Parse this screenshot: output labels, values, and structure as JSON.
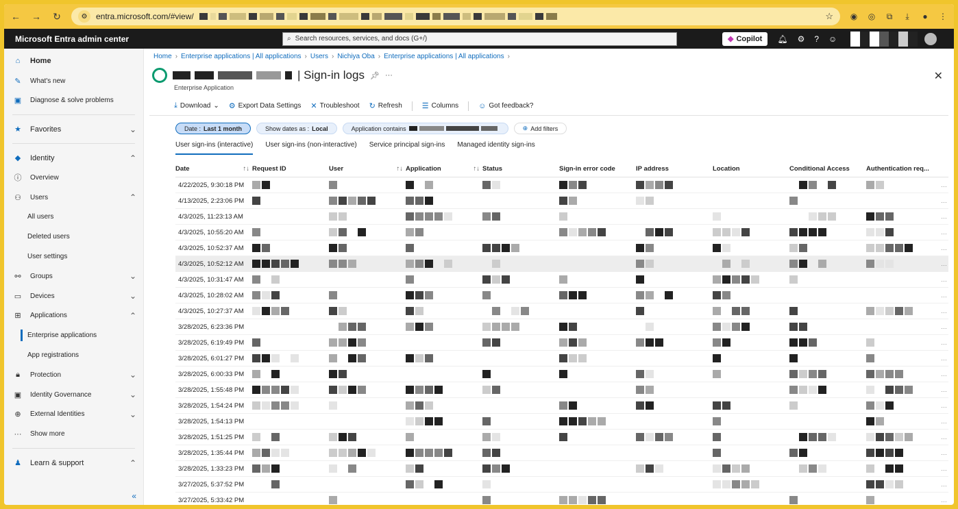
{
  "browser": {
    "url": "entra.microsoft.com/#view/",
    "icons": [
      "back-icon",
      "forward-icon",
      "reload-icon",
      "site-settings-icon",
      "star-icon",
      "download-icon",
      "menu-icon"
    ]
  },
  "portal": {
    "title": "Microsoft Entra admin center",
    "search_placeholder": "Search resources, services, and docs (G+/)",
    "copilot_label": "Copilot"
  },
  "sidebar": {
    "items": [
      {
        "label": "Home",
        "icon": "home-icon"
      },
      {
        "label": "What's new",
        "icon": "megaphone-icon"
      },
      {
        "label": "Diagnose & solve problems",
        "icon": "diagnose-icon"
      },
      {
        "label": "Favorites",
        "icon": "star-icon"
      },
      {
        "label": "Identity",
        "icon": "diamond-icon"
      },
      {
        "label": "Overview",
        "icon": "info-icon"
      },
      {
        "label": "Users",
        "icon": "user-icon"
      },
      {
        "label": "All users"
      },
      {
        "label": "Deleted users"
      },
      {
        "label": "User settings"
      },
      {
        "label": "Groups",
        "icon": "groups-icon"
      },
      {
        "label": "Devices",
        "icon": "devices-icon"
      },
      {
        "label": "Applications",
        "icon": "apps-icon"
      },
      {
        "label": "Enterprise applications"
      },
      {
        "label": "App registrations"
      },
      {
        "label": "Protection",
        "icon": "lock-icon"
      },
      {
        "label": "Identity Governance",
        "icon": "governance-icon"
      },
      {
        "label": "External Identities",
        "icon": "external-icon"
      },
      {
        "label": "Show more",
        "icon": "more-icon"
      },
      {
        "label": "Learn & support",
        "icon": "learn-icon"
      }
    ]
  },
  "breadcrumbs": [
    "Home",
    "Enterprise applications | All applications",
    "Users",
    "Nichiya Oba",
    "Enterprise applications | All applications"
  ],
  "page": {
    "title": "| Sign-in logs",
    "subtitle": "Enterprise Application"
  },
  "toolbar": {
    "download": "Download",
    "export": "Export Data Settings",
    "troubleshoot": "Troubleshoot",
    "refresh": "Refresh",
    "columns": "Columns",
    "feedback": "Got feedback?"
  },
  "filters": {
    "date_prefix": "Date : ",
    "date_value": "Last 1 month",
    "tz_prefix": "Show dates as : ",
    "tz_value": "Local",
    "app_prefix": "Application contains",
    "add_filters": "Add filters"
  },
  "tabs": [
    "User sign-ins (interactive)",
    "User sign-ins (non-interactive)",
    "Service principal sign-ins",
    "Managed identity sign-ins"
  ],
  "table": {
    "columns": [
      "Date",
      "Request ID",
      "User",
      "Application",
      "Status",
      "Sign-in error code",
      "IP address",
      "Location",
      "Conditional Access",
      "Authentication req..."
    ],
    "rows": [
      "4/22/2025, 9:30:18 PM",
      "4/13/2025, 2:23:06 PM",
      "4/3/2025, 11:23:13 AM",
      "4/3/2025, 10:55:20 AM",
      "4/3/2025, 10:52:37 AM",
      "4/3/2025, 10:52:12 AM",
      "4/3/2025, 10:31:47 AM",
      "4/3/2025, 10:28:02 AM",
      "4/3/2025, 10:27:37 AM",
      "3/28/2025, 6:23:36 PM",
      "3/28/2025, 6:19:49 PM",
      "3/28/2025, 6:01:27 PM",
      "3/28/2025, 6:00:33 PM",
      "3/28/2025, 1:55:48 PM",
      "3/28/2025, 1:54:24 PM",
      "3/28/2025, 1:54:13 PM",
      "3/28/2025, 1:51:25 PM",
      "3/28/2025, 1:35:44 PM",
      "3/28/2025, 1:33:23 PM",
      "3/27/2025, 5:37:52 PM",
      "3/27/2025, 5:33:42 PM"
    ]
  },
  "colors": {
    "accent": "#0f6cbd",
    "browser_chrome": "#f5c842",
    "portal_header": "#1b1b1b"
  }
}
